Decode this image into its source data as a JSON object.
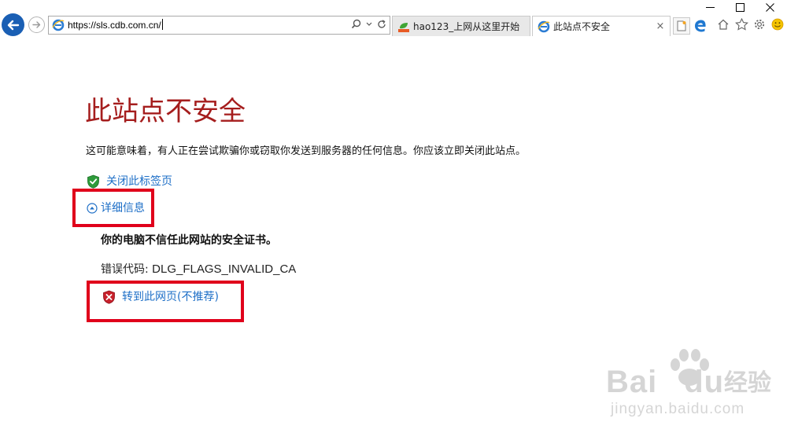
{
  "browser": {
    "url": "https://sls.cdb.com.cn/",
    "tabs": [
      {
        "label": "hao123_上网从这里开始",
        "active": false
      },
      {
        "label": "此站点不安全",
        "active": true
      }
    ],
    "tab_close_glyph": "×"
  },
  "content": {
    "title": "此站点不安全",
    "description": "这可能意味着，有人正在尝试欺骗你或窃取你发送到服务器的任何信息。你应该立即关闭此站点。",
    "close_tab_label": "关闭此标签页",
    "details_label": "详细信息",
    "detail_heading": "你的电脑不信任此网站的安全证书。",
    "error_code_label": "错误代码: ",
    "error_code_value": "DLG_FLAGS_INVALID_CA",
    "proceed_label": "转到此网页(不推荐)"
  },
  "watermark": {
    "brand": "Bai",
    "brand_suffix": "du",
    "brand_cn": "经验",
    "url": "jingyan.baidu.com"
  },
  "colors": {
    "title": "#a51d1d",
    "link": "#1e6fc7",
    "highlight": "#e0001b",
    "back_button": "#1a5fb4"
  }
}
